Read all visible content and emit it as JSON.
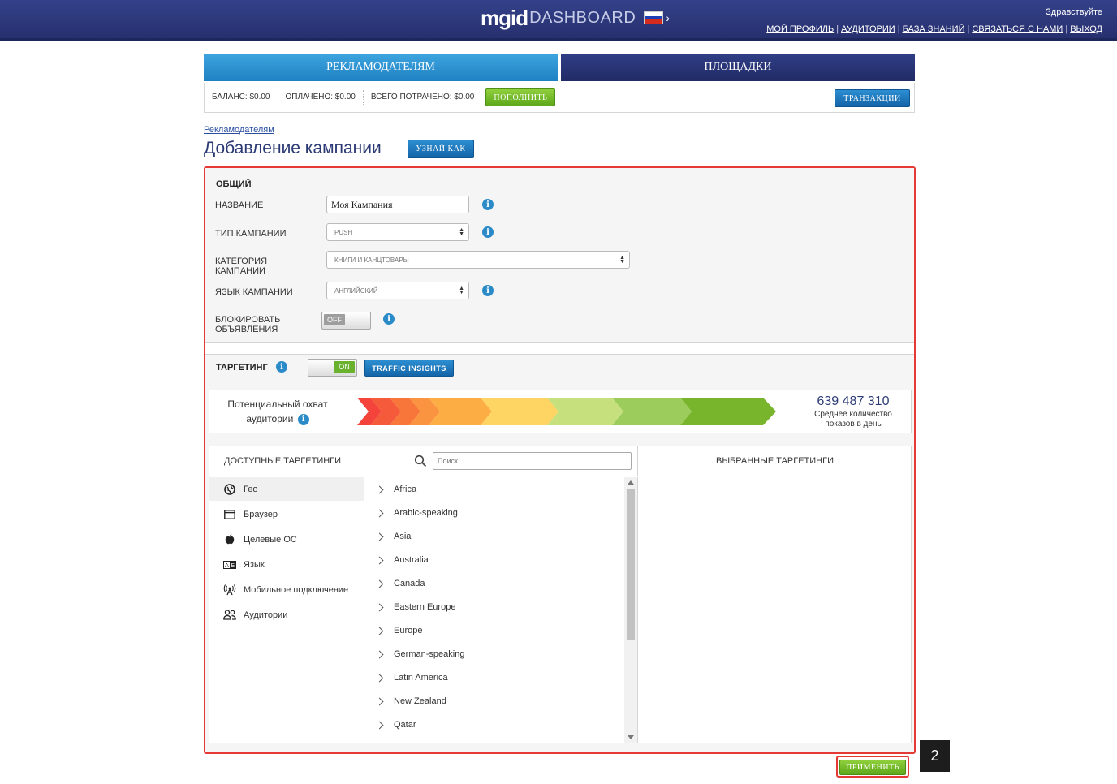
{
  "header": {
    "logo_main": "mgid",
    "logo_sub": "DASHBOARD",
    "greeting": "Здравствуйте",
    "links": [
      "МОЙ ПРОФИЛЬ",
      "АУДИТОРИИ",
      "БАЗА ЗНАНИЙ",
      "СВЯЗАТЬСЯ С НАМИ",
      "ВЫХОД"
    ]
  },
  "tabs": {
    "advertisers": "РЕКЛАМОДАТЕЛЯМ",
    "publishers": "ПЛОЩАДКИ"
  },
  "balance": {
    "balance": "БАЛАНС:  $0.00",
    "paid": "ОПЛАЧЕНО:  $0.00",
    "spent": "ВСЕГО ПОТРАЧЕНО:  $0.00",
    "topup_label": "ПОПОЛНИТЬ",
    "transactions_label": "ТРАНЗАКЦИИ"
  },
  "breadcrumb": "Рекламодателям",
  "page_title": "Добавление кампании",
  "learn_label": "УЗНАЙ КАК",
  "general": {
    "title": "ОБЩИЙ",
    "name_label": "НАЗВАНИЕ",
    "name_value": "Моя Кампания",
    "type_label": "ТИП КАМПАНИИ",
    "type_value": "PUSH",
    "category_label_1": "КАТЕГОРИЯ",
    "category_label_2": "КАМПАНИИ",
    "category_value": "КНИГИ И КАНЦТОВАРЫ",
    "language_label": "ЯЗЫК КАМПАНИИ",
    "language_value": "АНГЛИЙСКИЙ",
    "block_label_1": "БЛОКИРОВАТЬ",
    "block_label_2": "ОБЪЯВЛЕНИЯ",
    "block_toggle": "OFF"
  },
  "targeting": {
    "title": "ТАРГЕТИНГ",
    "toggle": "ON",
    "insights_label": "TRAFFIC INSIGHTS",
    "reach_label_1": "Потенциальный охват",
    "reach_label_2": "аудитории",
    "reach_value": "639 487 310",
    "reach_sub_1": "Среднее количество",
    "reach_sub_2": "показов в день",
    "available_title": "ДОСТУПНЫЕ ТАРГЕТИНГИ",
    "search_placeholder": "Поиск",
    "selected_title": "ВЫБРАННЫЕ ТАРГЕТИНГИ",
    "categories": [
      {
        "label": "Гео",
        "icon": "globe-icon"
      },
      {
        "label": "Браузер",
        "icon": "browser-window-icon"
      },
      {
        "label": "Целевые ОС",
        "icon": "apple-icon"
      },
      {
        "label": "Язык",
        "icon": "language-icon"
      },
      {
        "label": "Мобильное подключение",
        "icon": "antenna-icon"
      },
      {
        "label": "Аудитории",
        "icon": "users-icon"
      }
    ],
    "regions": [
      "Africa",
      "Arabic-speaking",
      "Asia",
      "Australia",
      "Canada",
      "Eastern Europe",
      "Europe",
      "German-speaking",
      "Latin America",
      "New Zealand",
      "Qatar"
    ]
  },
  "apply_label": "ПРИМЕНИТЬ",
  "step_badge": "2",
  "colors": {
    "accent_blue": "#2a8bc8",
    "header_navy": "#2b3575",
    "highlight_red": "#e53935",
    "action_green": "#6ab22e"
  }
}
